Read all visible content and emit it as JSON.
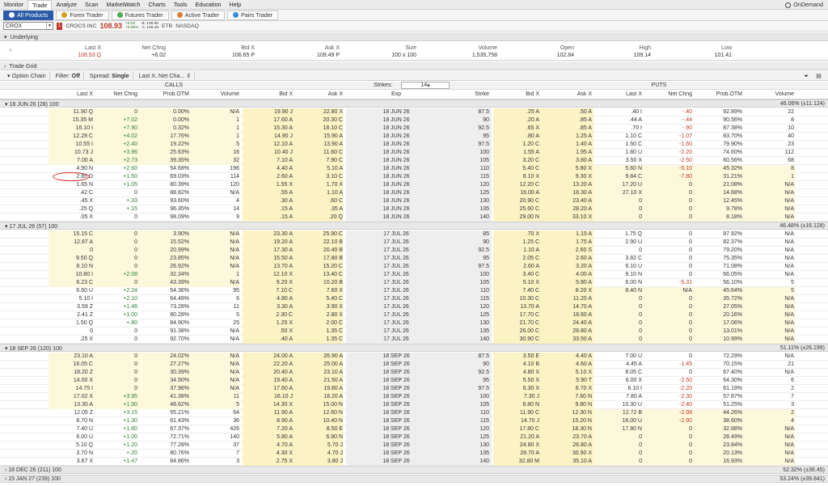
{
  "menu": {
    "items": [
      "Monitor",
      "Trade",
      "Analyze",
      "Scan",
      "MarketWatch",
      "Charts",
      "Tools",
      "Education",
      "Help"
    ],
    "active": 1,
    "ondemand": "OnDemand"
  },
  "subtabs": [
    {
      "label": "All Products",
      "active": true,
      "color": "#ffffff"
    },
    {
      "label": "Forex Trader",
      "active": false,
      "color": "#d4a017"
    },
    {
      "label": "Futures Trader",
      "active": false,
      "color": "#4caf50"
    },
    {
      "label": "Active Trader",
      "active": false,
      "color": "#e07b39"
    },
    {
      "label": "Pairs Trader",
      "active": false,
      "color": "#3a8dde"
    }
  ],
  "symbol": {
    "ticker": "CROX",
    "badge": "1",
    "name": "CROCS INC",
    "price": "108.93",
    "chg_top": "+6.02",
    "chg_bot": "+5.85%",
    "bid_top": "B: 106.65",
    "ask_bot": "A: 109.49",
    "etb": "ETB",
    "exchange": "NASDAQ"
  },
  "underlying": {
    "title": "Underlying",
    "headers": [
      "Last X",
      "Net Chng",
      "Bid X",
      "Ask X",
      "Size",
      "Volume",
      "Open",
      "High",
      "Low"
    ],
    "values": [
      "108.93 Q",
      "+6.02",
      "106.65 P",
      "109.49 P",
      "100 x 100",
      "1,535,758",
      "102.84",
      "109.14",
      "101.41"
    ]
  },
  "tradegrid": "Trade Grid",
  "optbar": {
    "title": "Option Chain",
    "filter_label": "Filter:",
    "filter_value": "Off",
    "spread_label": "Spread:",
    "spread_value": "Single",
    "layout": "Last X, Net Cha...",
    "strikes_label": "Strikes:",
    "strikes_value": "14"
  },
  "sections": {
    "calls": "CALLS",
    "puts": "PUTS"
  },
  "columns": {
    "calls": [
      "Last X",
      "Net Chng",
      "Prob.OTM",
      "Volume",
      "Bid X",
      "Ask X"
    ],
    "mid": [
      "Exp",
      "Strike"
    ],
    "puts": [
      "Bid X",
      "Ask X",
      "Last X",
      "Net Chng",
      "Prob.OTM",
      "Volume"
    ]
  },
  "expirations": [
    {
      "label": "18 JUN 26",
      "days": "(28)",
      "mult": "100",
      "iv": "46.06% (±11.124)",
      "rows": [
        [
          "11.90 Q",
          "0",
          "0.00%",
          "N/A",
          "19.90 J",
          "22.80 X",
          "18 JUN 26",
          "87.5",
          ".25 A",
          ".50 A",
          ".40 I",
          "-.40",
          "92.89%",
          "22"
        ],
        [
          "15.35 M",
          "+7.02",
          "0.00%",
          "1",
          "17.60 A",
          "20.30 C",
          "18 JUN 26",
          "90",
          ".20 A",
          ".85 A",
          ".44 A",
          "-.44",
          "90.56%",
          "8"
        ],
        [
          "16.10 I",
          "+7.90",
          "0.32%",
          "1",
          "15.30 A",
          "18.10 C",
          "18 JUN 26",
          "92.5",
          ".65 X",
          ".85 A",
          ".70 I",
          "-.90",
          "87.38%",
          "10"
        ],
        [
          "12.28 C",
          "+4.02",
          "17.76%",
          "1",
          "14.90 J",
          "15.90 A",
          "18 JUN 26",
          "95",
          ".80 A",
          "1.25 A",
          "1.10 C",
          "-1.07",
          "83.70%",
          "40"
        ],
        [
          "10.55 I",
          "+2.40",
          "19.22%",
          "5",
          "12.10 A",
          "13.90 A",
          "18 JUN 26",
          "97.5",
          "1.20 C",
          "1.40 A",
          "1.50 C",
          "-1.60",
          "79.90%",
          "23"
        ],
        [
          "10.73 J",
          "+3.96",
          "25.63%",
          "16",
          "10.40 J",
          "11.60 C",
          "18 JUN 26",
          "100",
          "1.55 A",
          "1.95 A",
          "1.80 U",
          "-2.20",
          "74.60%",
          "112"
        ],
        [
          "7.00 A",
          "+2.73",
          "39.35%",
          "32",
          "7.10 A",
          "7.90 C",
          "18 JUN 26",
          "105",
          "3.20 C",
          "3.80 A",
          "3.50 X",
          "-2.50",
          "60.56%",
          "68"
        ],
        [
          "4.90 N",
          "+2.60",
          "54.68%",
          "196",
          "4.40 A",
          "5.10 A",
          "18 JUN 26",
          "110",
          "5.40 C",
          "5.80 X",
          "5.60 N",
          "-5.10",
          "45.32%",
          "8"
        ],
        [
          "2.85 D",
          "+1.50",
          "69.03%",
          "114",
          "2.60 A",
          "3.10 C",
          "18 JUN 26",
          "115",
          "8.10 X",
          "9.30 X",
          "9.84 C",
          "-7.80",
          "31.21%",
          "1"
        ],
        [
          "1.65 N",
          "+1.05",
          "80.39%",
          "120",
          "1.55 X",
          "1.70 X",
          "18 JUN 26",
          "120",
          "12.20 C",
          "13.20 A",
          "17.20 U",
          "0",
          "21.08%",
          "N/A"
        ],
        [
          ".42 C",
          "0",
          "88.82%",
          "N/A",
          ".55 A",
          "1.10 A",
          "18 JUN 26",
          "125",
          "16.00 A",
          "18.30 A",
          "27.10 X",
          "0",
          "14.68%",
          "N/A"
        ],
        [
          ".45 X",
          "+.33",
          "93.60%",
          "4",
          ".30 A",
          ".60 C",
          "18 JUN 26",
          "130",
          "20.90 C",
          "23.40 A",
          "0",
          "0",
          "12.45%",
          "N/A"
        ],
        [
          ".25 Q",
          "+.15",
          "96.35%",
          "14",
          ".15 A",
          ".35 A",
          "18 JUN 26",
          "135",
          "25.60 C",
          "28.20 A",
          "0",
          "0",
          "9.78%",
          "N/A"
        ],
        [
          ".05 X",
          "0",
          "98.09%",
          "9",
          ".15 A",
          ".20 Q",
          "18 JUN 26",
          "140",
          "29.00 N",
          "33.10 X",
          "0",
          "0",
          "8.18%",
          "N/A"
        ]
      ]
    },
    {
      "label": "17 JUL 26",
      "days": "(57)",
      "mult": "100",
      "iv": "46.48% (±16.128)",
      "rows": [
        [
          "15.15 C",
          "0",
          "3.90%",
          "N/A",
          "23.30 A",
          "25.90 C",
          "17 JUL 26",
          "85",
          ".70 X",
          "1.15 A",
          "1.75 Q",
          "0",
          "87.92%",
          "N/A"
        ],
        [
          "12.87 A",
          "0",
          "15.52%",
          "N/A",
          "19.20 A",
          "22.10 B",
          "17 JUL 26",
          "90",
          "1.25 C",
          "1.75 A",
          "2.90 U",
          "0",
          "82.37%",
          "N/A"
        ],
        [
          "0",
          "0",
          "20.99%",
          "N/A",
          "17.30 A",
          "20.40 B",
          "17 JUL 26",
          "92.5",
          "1.10 A",
          "2.60 S",
          "0",
          "0",
          "79.20%",
          "N/A"
        ],
        [
          "9.50 Q",
          "0",
          "23.85%",
          "N/A",
          "15.50 A",
          "17.80 B",
          "17 JUL 26",
          "95",
          "2.05 C",
          "2.60 A",
          "3.82 C",
          "0",
          "75.35%",
          "N/A"
        ],
        [
          "8.10 N",
          "0",
          "26.92%",
          "N/A",
          "13.70 A",
          "15.20 C",
          "17 JUL 26",
          "97.5",
          "2.60 A",
          "3.20 A",
          "6.10 U",
          "0",
          "71.08%",
          "N/A"
        ],
        [
          "10.80 I",
          "+2.08",
          "32.34%",
          "1",
          "12.10 X",
          "13.40 C",
          "17 JUL 26",
          "100",
          "3.40 C",
          "4.00 A",
          "9.10 N",
          "0",
          "66.05%",
          "N/A"
        ],
        [
          "6.23 C",
          "0",
          "43.39%",
          "N/A",
          "9.20 X",
          "10.20 B",
          "17 JUL 26",
          "105",
          "5.10 X",
          "5.80 A",
          "6.00 N",
          "-5.31",
          "56.10%",
          "5"
        ],
        [
          "6.60 U",
          "+2.24",
          "54.36%",
          "95",
          "7.10 C",
          "7.60 X",
          "17 JUL 26",
          "110",
          "7.40 C",
          "8.20 X",
          "8.40 N",
          "N/A",
          "45.64%",
          "5"
        ],
        [
          "5.10 I",
          "+2.10",
          "64.48%",
          "6",
          "4.80 A",
          "5.40 C",
          "17 JUL 26",
          "115",
          "10.30 C",
          "11.20 A",
          "0",
          "0",
          "35.72%",
          "N/A"
        ],
        [
          "3.59 Z",
          "+1.46",
          "73.28%",
          "11",
          "3.30 A",
          "3.90 X",
          "17 JUL 26",
          "120",
          "13.70 A",
          "14.70 A",
          "0",
          "0",
          "27.05%",
          "N/A"
        ],
        [
          "2.41 Z",
          "+1.00",
          "80.28%",
          "5",
          "2.30 C",
          "2.80 X",
          "17 JUL 26",
          "125",
          "17.70 C",
          "18.60 A",
          "0",
          "0",
          "20.16%",
          "N/A"
        ],
        [
          "1.50 Q",
          "+.80",
          "84.90%",
          "25",
          "1.25 X",
          "2.00 C",
          "17 JUL 26",
          "130",
          "21.70 C",
          "24.40 A",
          "0",
          "0",
          "17.06%",
          "N/A"
        ],
        [
          "0",
          "0",
          "91.38%",
          "N/A",
          ".50 X",
          "1.35 C",
          "17 JUL 26",
          "135",
          "26.00 C",
          "28.80 A",
          "0",
          "0",
          "13.01%",
          "N/A"
        ],
        [
          ".25 X",
          "0",
          "92.70%",
          "N/A",
          ".40 A",
          "1.35 C",
          "17 JUL 26",
          "140",
          "30.90 C",
          "33.50 A",
          "0",
          "0",
          "10.99%",
          "N/A"
        ]
      ]
    },
    {
      "label": "18 SEP 26",
      "days": "(120)",
      "mult": "100",
      "iv": "51.11% (±26.199)",
      "rows": [
        [
          "23.10 A",
          "0",
          "24.02%",
          "N/A",
          "24.00 A",
          "26.90 A",
          "18 SEP 26",
          "87.5",
          "3.50 E",
          "4.40 A",
          "7.00 U",
          "0",
          "72.29%",
          "N/A"
        ],
        [
          "16.05 C",
          "0",
          "27.27%",
          "N/A",
          "22.20 A",
          "25.00 A",
          "18 SEP 26",
          "90",
          "4.10 B",
          "4.60 A",
          "4.45 A",
          "-1.45",
          "70.15%",
          "21"
        ],
        [
          "18.20 Z",
          "0",
          "30.39%",
          "N/A",
          "20.40 A",
          "23.10 A",
          "18 SEP 26",
          "92.5",
          "4.80 X",
          "5.10 X",
          "8.05 C",
          "0",
          "67.40%",
          "N/A"
        ],
        [
          "14.00 X",
          "0",
          "34.90%",
          "N/A",
          "19.40 A",
          "21.50 A",
          "18 SEP 26",
          "95",
          "5.50 X",
          "5.90 T",
          "6.00 X",
          "-2.50",
          "64.30%",
          "6"
        ],
        [
          "14.75 I",
          "0",
          "37.96%",
          "N/A",
          "17.60 A",
          "19.80 A",
          "18 SEP 26",
          "97.5",
          "6.30 X",
          "6.70 X",
          "6.10 I",
          "-2.20",
          "61.19%",
          "2"
        ],
        [
          "17.02 X",
          "+3.95",
          "41.38%",
          "11",
          "16.10 J",
          "18.20 A",
          "18 SEP 26",
          "100",
          "7.30 J",
          "7.60 N",
          "7.80 A",
          "-2.30",
          "57.87%",
          "7"
        ],
        [
          "13.30 A",
          "+1.90",
          "48.62%",
          "5",
          "14.30 X",
          "15.00 N",
          "18 SEP 26",
          "105",
          "8.80 N",
          "9.80 N",
          "10.30 U",
          "-2.40",
          "51.25%",
          "3"
        ],
        [
          "12.05 Z",
          "+3.15",
          "55.21%",
          "64",
          "11.90 A",
          "12.60 N",
          "18 SEP 26",
          "110",
          "11.90 C",
          "12.30 N",
          "12.72 B",
          "-2.98",
          "44.26%",
          "2"
        ],
        [
          "8.70 N",
          "+1.30",
          "61.43%",
          "36",
          "8.90 A",
          "10.40 N",
          "18 SEP 26",
          "115",
          "14.70 J",
          "15.20 N",
          "16.00 U",
          "-2.90",
          "38.60%",
          "4"
        ],
        [
          "7.40 U",
          "+1.60",
          "67.37%",
          "426",
          "7.20 A",
          "8.50 E",
          "18 SEP 26",
          "120",
          "17.80 C",
          "18.30 N",
          "17.80 N",
          "0",
          "32.88%",
          "N/A"
        ],
        [
          "6.00 U",
          "+1.00",
          "72.71%",
          "140",
          "5.80 A",
          "6.90 N",
          "18 SEP 26",
          "125",
          "21.20 A",
          "23.70 A",
          "0",
          "0",
          "28.49%",
          "N/A"
        ],
        [
          "5.10 Q",
          "+1.20",
          "77.28%",
          "37",
          "4.70 A",
          "5.70 J",
          "18 SEP 26",
          "130",
          "24.80 X",
          "26.80 A",
          "0",
          "0",
          "23.84%",
          "N/A"
        ],
        [
          "3.70 N",
          "+.20",
          "80.76%",
          "7",
          "4.30 X",
          "4.70 J",
          "18 SEP 26",
          "135",
          "28.70 A",
          "30.90 X",
          "0",
          "0",
          "20.13%",
          "N/A"
        ],
        [
          "3.67 X",
          "+1.47",
          "84.86%",
          "3",
          "2.75 X",
          "3.80 J",
          "18 SEP 26",
          "140",
          "32.80 M",
          "35.10 A",
          "0",
          "0",
          "16.93%",
          "N/A"
        ]
      ]
    }
  ],
  "collapsed": [
    {
      "label": "18 DEC 26",
      "days": "(211)",
      "mult": "100",
      "iv": "52.32% (±36.45)"
    },
    {
      "label": "15 JAN 27",
      "days": "(239)",
      "mult": "100",
      "iv": "53.24% (±39.841)"
    }
  ],
  "colors": {
    "itm": "#fcf8dc",
    "bidask": "#fbf3c4",
    "negative": "#c0392b",
    "positive": "#2e7d32",
    "highlight_oval": "#d12a2a"
  }
}
